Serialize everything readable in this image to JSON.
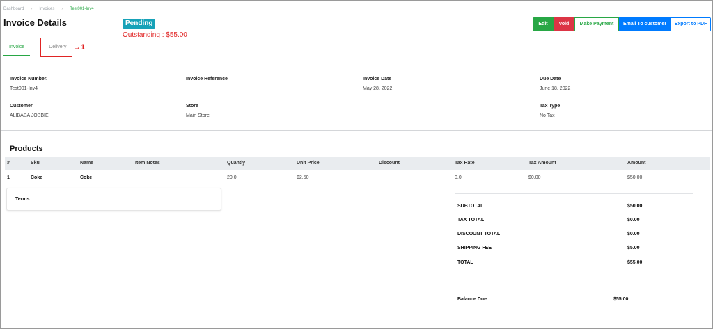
{
  "breadcrumb": [
    "Dashboard",
    "Invoices",
    "Test001-Inv4"
  ],
  "page_title": "Invoice Details",
  "status": "Pending",
  "outstanding": "Outstanding : $55.00",
  "actions": {
    "edit": "Edit",
    "void": "Void",
    "make_payment": "Make Payment",
    "email": "Email To customer",
    "export": "Export to PDF"
  },
  "tabs": [
    {
      "label": "Invoice",
      "active": true
    },
    {
      "label": "Delivery",
      "active": false
    }
  ],
  "annotation": "1",
  "details": {
    "invoice_number": {
      "label": "Invoice Number.",
      "value": "Test001-Inv4"
    },
    "invoice_reference": {
      "label": "Invoice Reference",
      "value": ""
    },
    "invoice_date": {
      "label": "Invoice Date",
      "value": "May 28, 2022"
    },
    "due_date": {
      "label": "Due Date",
      "value": "June 18, 2022"
    },
    "customer": {
      "label": "Customer",
      "value": "ALIBABA JOBBIE"
    },
    "store": {
      "label": "Store",
      "value": "Main Store"
    },
    "tax_type": {
      "label": "Tax Type",
      "value": "No Tax"
    }
  },
  "products": {
    "title": "Products",
    "columns": [
      "#",
      "Sku",
      "Name",
      "Item Notes",
      "Quantiy",
      "Unit Price",
      "Discount",
      "Tax Rate",
      "Tax Amount",
      "Amount"
    ],
    "rows": [
      [
        "1",
        "Coke",
        "Coke",
        "",
        "20.0",
        "$2.50",
        "",
        "0.0",
        "$0.00",
        "$50.00"
      ]
    ]
  },
  "terms_label": "Terms:",
  "summary": {
    "subtotal": {
      "label": "SUBTOTAL",
      "value": "$50.00"
    },
    "tax_total": {
      "label": "TAX TOTAL",
      "value": "$0.00"
    },
    "discount_total": {
      "label": "DISCOUNT TOTAL",
      "value": "$0.00"
    },
    "shipping_fee": {
      "label": "SHIPPING FEE",
      "value": "$5.00"
    },
    "total": {
      "label": "TOTAL",
      "value": "$55.00"
    },
    "balance_due": {
      "label": "Balance Due",
      "value": "$55.00"
    }
  },
  "colors": {
    "success": "#28a745",
    "danger": "#dc3545",
    "primary": "#007bff",
    "info": "#17a2b8",
    "outstanding": "#e02424"
  }
}
